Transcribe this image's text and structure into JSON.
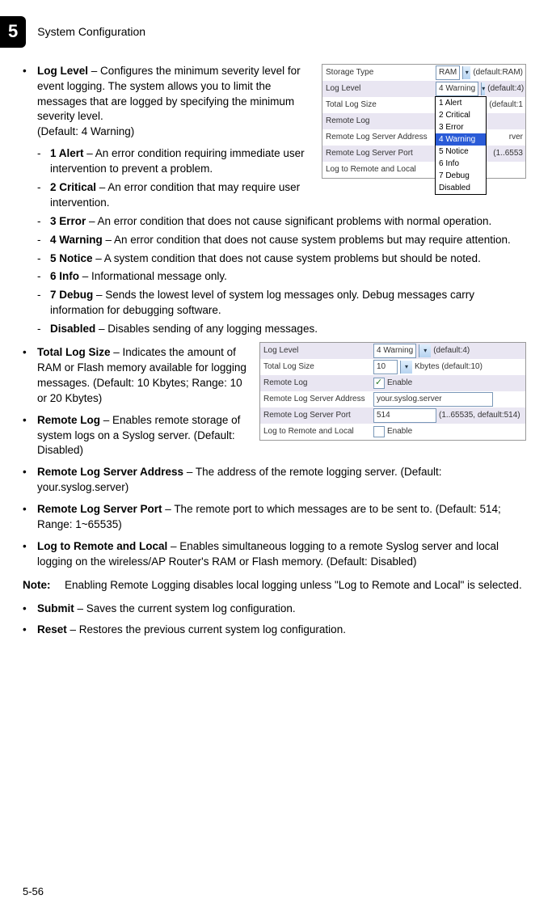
{
  "header": {
    "chapter": "5",
    "title": "System Configuration"
  },
  "panel1": {
    "rows": {
      "storage_type": {
        "label": "Storage Type",
        "value": "RAM",
        "hint": "(default:RAM)"
      },
      "log_level": {
        "label": "Log Level",
        "value": "4 Warning",
        "hint": "(default:4)"
      },
      "total_log_size": {
        "label": "Total Log Size",
        "hint": "(default:1"
      },
      "remote_log": {
        "label": "Remote Log"
      },
      "remote_addr": {
        "label": "Remote Log Server Address",
        "tail": "rver"
      },
      "remote_port": {
        "label": "Remote Log Server Port",
        "hint": "(1..6553"
      },
      "log_remote_local": {
        "label": "Log to Remote and Local"
      }
    },
    "dropdown": {
      "options": [
        "1 Alert",
        "2 Critical",
        "3 Error",
        "4 Warning",
        "5 Notice",
        "6 Info",
        "7 Debug",
        "Disabled"
      ],
      "selected": "4 Warning"
    }
  },
  "panel2": {
    "rows": {
      "log_level": {
        "label": "Log Level",
        "value": "4 Warning",
        "hint": "(default:4)"
      },
      "total_log_size": {
        "label": "Total Log Size",
        "value": "10",
        "hint": "Kbytes (default:10)"
      },
      "remote_log": {
        "label": "Remote Log",
        "chk_label": "Enable",
        "checked": true
      },
      "remote_addr": {
        "label": "Remote Log Server Address",
        "value": "your.syslog.server"
      },
      "remote_port": {
        "label": "Remote Log Server Port",
        "value": "514",
        "hint": "(1..65535, default:514)"
      },
      "log_remote_local": {
        "label": "Log to Remote and Local",
        "chk_label": "Enable",
        "checked": false
      }
    }
  },
  "text": {
    "log_level_label": "Log Level",
    "log_level_desc": " – Configures the minimum severity level for event logging. The system allows you to limit the messages that are logged by specifying the minimum severity level.",
    "log_level_default": "(Default: 4 Warning)",
    "lv1_label": "1 Alert",
    "lv1_desc": " – An error condition requiring immediate user intervention to prevent a problem.",
    "lv2_label": "2 Critical",
    "lv2_desc": " – An error condition that may require user intervention.",
    "lv3_label": "3 Error",
    "lv3_desc": " – An error condition that does not cause significant problems with normal operation.",
    "lv4_label": "4 Warning",
    "lv4_desc": " – An error condition that does not cause system problems but may require attention.",
    "lv5_label": "5 Notice",
    "lv5_desc": " – A system condition that does not cause system problems but should be noted.",
    "lv6_label": "6 Info",
    "lv6_desc": " – Informational message only.",
    "lv7_label": "7 Debug",
    "lv7_desc": " – Sends the lowest level of system log messages only. Debug messages carry information for debugging software.",
    "lvd_label": "Disabled",
    "lvd_desc": " – Disables sending of any logging messages.",
    "total_log_label": "Total Log Size",
    "total_log_desc": " – Indicates the amount of RAM or Flash memory available for logging messages. (Default: 10 Kbytes; Range: 10 or 20 Kbytes)",
    "remote_log_label": "Remote Log",
    "remote_log_desc": " – Enables remote storage of system logs on a Syslog server. (Default: Disabled)",
    "remote_addr_label": "Remote Log Server Address",
    "remote_addr_desc": " – The address of the remote logging server. (Default: your.syslog.server)",
    "remote_port_label": "Remote Log Server Port",
    "remote_port_desc": " – The remote port to which messages are to be sent to. (Default: 514; Range: 1~65535)",
    "log_rl_label": "Log to Remote and Local",
    "log_rl_desc": " – Enables simultaneous logging to a remote Syslog server and local logging on the wireless/AP Router's RAM or Flash memory. (Default: Disabled)",
    "note_label": "Note:",
    "note_text": "Enabling Remote Logging disables local logging unless \"Log to Remote and Local\" is selected.",
    "submit_label": "Submit",
    "submit_desc": " – Saves the current system log configuration.",
    "reset_label": "Reset",
    "reset_desc": " – Restores the previous current system log configuration."
  },
  "page_number": "5-56"
}
